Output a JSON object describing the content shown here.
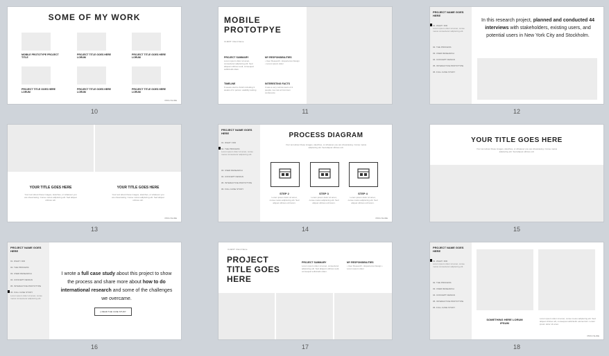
{
  "slides": [
    {
      "number": "10",
      "title": "SOME OF MY WORK",
      "captions": [
        "MOBILE PROTOTYPE PROJECT TITLE",
        "PROJECT TITLE GOES HERE LORUM",
        "PROJECT TITLE GOES HERE LORUM",
        "PROJECT TITLE GOES HERE LORUM",
        "PROJECT TITLE GOES HERE LORUM",
        "PROJECT TITLE GOES HERE LORUM"
      ],
      "logo": "PROJ.SLIDE"
    },
    {
      "number": "11",
      "title": "MOBILE PROTOTPYE",
      "client": "CLIENT: Client Name",
      "sections": [
        {
          "heading": "PROJECT SUMMARY",
          "body": "Lorem ipsum dolor sit amet, consectetur adipiscing elit. Sed aliquam ultrices sodi, consequat sollicitudin diam."
        },
        {
          "heading": "MY RESPONSIBILITIES",
          "body": "• User Research • Experience Design • Lorem ipsum dolor"
        },
        {
          "heading": "TIMELINE",
          "body": "6 weeks start to finish including 3 weeks of in person usability testing"
        },
        {
          "heading": "INTERESTING FACTS",
          "body": "It was a very narrow team of 4 people, we met at Common conference"
        }
      ]
    },
    {
      "number": "12",
      "project_name": "PROJECT NAME GOES HERE",
      "nav_items": [
        "01. WHAT I DID",
        "02. THE PROCESS",
        "03. USER RESEARCH",
        "04. CONCEPT DESIGN",
        "05. INTERACTIVE PROTOTYPE",
        "06. FULL CASE STUDY"
      ],
      "body_parts": [
        "In this research project, ",
        "planned and conducted 44 interviews",
        " with stakeholders, existing users, and potential users in New York City and Stockholm."
      ]
    },
    {
      "number": "13",
      "titles": [
        "YOUR TITLE GOES HERE",
        "YOUR TITLE GOES HERE"
      ],
      "body": "Your text about these images, sketches, or whatever you are showcasing. Conse metus adipiscing elit. Sed aliquet ultrices odi.",
      "logo": "PROJ.SLIDE"
    },
    {
      "number": "14",
      "project_name": "PROJECT NAME GOES HERE",
      "nav_items": [
        "01. WHAT I DID",
        "02. THE PROCESS",
        "03. USER RESEARCH",
        "04. CONCEPT DESIGN",
        "05. INTERACTIVE PROTOTYPE",
        "06. FULL CASE STUDY"
      ],
      "title": "PROCESS DIAGRAM",
      "intro": "Your text about these images, sketches, or whatever you are showcasing. Conse metus adipiscing elit. Sed aliquet ultrices odi.",
      "steps": [
        {
          "label": "STEP 2",
          "body": "Lorem ipsum dolor sit amet, conse metus adipiscing elit. Sed aliquet ultrices odi lorem."
        },
        {
          "label": "STEP 3",
          "body": "Lorem ipsum dolor sit amet, conse metus adipiscing elit. Sed aliquet ultrices odi lorem."
        },
        {
          "label": "STEP 4",
          "body": "Lorem ipsum dolor sit amet, conse metus adipiscing elit. Sed aliquet ultrices odi lorem."
        }
      ],
      "logo": "PROJ.SLIDE"
    },
    {
      "number": "15",
      "title": "YOUR TITLE GOES HERE",
      "body": "Your text about these images, sketches, or whatever you are showcasing. Conse metus adipiscing elit. Sed aliquet ultrices odi."
    },
    {
      "number": "16",
      "project_name": "PROJECT NAME GOES HERE",
      "nav_items": [
        "01. WHAT I DID",
        "02. THE PROCESS",
        "03. USER RESEARCH",
        "04. CONCEPT DESIGN",
        "05. INTERACTIVE PROTOTYPE",
        "06. FULL CASE STUDY"
      ],
      "body_parts": [
        "I wrote a ",
        "full case study",
        " about this project to show the process and share more about ",
        "how to do international research",
        " and some of the challenges we overcame."
      ],
      "button": "READ THE CASE STUDY"
    },
    {
      "number": "17",
      "client": "CLIENT: Client Name",
      "title": "PROJECT TITLE GOES HERE",
      "sections": [
        {
          "heading": "PROJECT SUMMARY",
          "body": "Lorem ipsum dolor sit amet, consectetur adipiscing elit. Sed aliquam ultrices sodi, consequat sollicitudin diam."
        },
        {
          "heading": "MY RESPONSIBILITIES",
          "body": "• User Research • Experience Design • Lorem ipsum dolor"
        }
      ]
    },
    {
      "number": "18",
      "project_name": "PROJECT NAME GOES HERE",
      "nav_items": [
        "01. WHAT I DID",
        "02. THE PROCESS",
        "03. USER RESEARCH",
        "04. CONCEPT DESIGN",
        "05. INTERACTIVE PROTOTYPE",
        "06. FULL CASE STUDY"
      ],
      "caption_title": "SOMETHING HERE LORUM IPSUM",
      "caption_body": "Lorem ipsum dolor sit amet, conse metus adipiscing elit. Sed aliquet ultrices odi, consequat sollicitudin elementum. Lorem ipsum dolor sit amet.",
      "logo": "PROJ.SLIDE"
    }
  ]
}
